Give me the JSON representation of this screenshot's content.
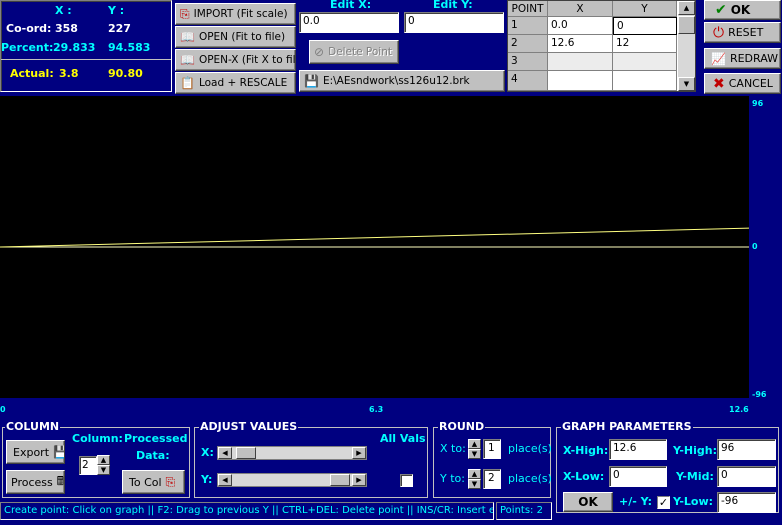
{
  "coords": {
    "x_header": "X :",
    "y_header": "Y :",
    "coord_label": "Co-ord:",
    "coord_x": "358",
    "coord_y": "227",
    "percent_label": "Percent:",
    "percent_x": "29.833",
    "percent_y": "94.583",
    "actual_label": "Actual:",
    "actual_x": "3.8",
    "actual_y": "90.80"
  },
  "file_buttons": {
    "import": "IMPORT (Fit scale)",
    "open": "OPEN   (Fit to file)",
    "open_x": "OPEN-X (Fit X to file)",
    "load_rescale": "Load + RESCALE"
  },
  "edit": {
    "edit_x_label": "Edit X:",
    "edit_y_label": "Edit Y:",
    "edit_x_value": "0.0",
    "edit_y_value": "0",
    "delete_point": "Delete Point",
    "file_path": "E:\\AEsndwork\\ss126u12.brk"
  },
  "grid": {
    "headers": [
      "POINT",
      "X",
      "Y"
    ],
    "rows": [
      {
        "point": "1",
        "x": "0.0",
        "y": "0"
      },
      {
        "point": "2",
        "x": "12.6",
        "y": "12"
      },
      {
        "point": "3",
        "x": "",
        "y": ""
      },
      {
        "point": "4",
        "x": "",
        "y": ""
      }
    ]
  },
  "actions": {
    "ok": "OK",
    "reset": "RESET",
    "redraw": "REDRAW",
    "cancel": "CANCEL"
  },
  "graph": {
    "x_min": 0,
    "x_max": 12.6,
    "y_min": -96,
    "y_max": 96,
    "x_ticks": [
      "0",
      "6.3",
      "12.6"
    ],
    "y_ticks": [
      "96",
      "0",
      "-96"
    ],
    "points": [
      [
        0.0,
        0
      ],
      [
        12.6,
        12
      ]
    ],
    "line_color": "#ffff80",
    "hline_y": 0,
    "hline_color": "#ffffc0"
  },
  "column": {
    "title": "COLUMN",
    "export": "Export",
    "process": "Process",
    "column_label": "Column:",
    "column_value": "2",
    "processed_label": "Processed",
    "data_label": "Data:",
    "to_col": "To Col"
  },
  "adjust": {
    "title": "ADJUST VALUES",
    "all_vals": "All Vals",
    "x_label": "X:",
    "y_label": "Y:"
  },
  "round": {
    "title": "ROUND",
    "x_to": "X to:",
    "x_value": "1",
    "y_to": "Y to:",
    "y_value": "2",
    "places": "place(s)"
  },
  "params": {
    "title": "GRAPH PARAMETERS",
    "x_high_label": "X-High:",
    "x_high": "12.6",
    "y_high_label": "Y-High:",
    "y_high": "96",
    "x_low_label": "X-Low:",
    "x_low": "0",
    "y_mid_label": "Y-Mid:",
    "y_mid": "0",
    "ok": "OK",
    "pm_y": "+/- Y:",
    "y_low_label": "Y-Low:",
    "y_low": "-96"
  },
  "status": {
    "hint": "Create point: Click on graph || F2: Drag to previous Y || CTRL+DEL: Delete point || INS/CR: Insert edit",
    "points": "Points:  2"
  }
}
